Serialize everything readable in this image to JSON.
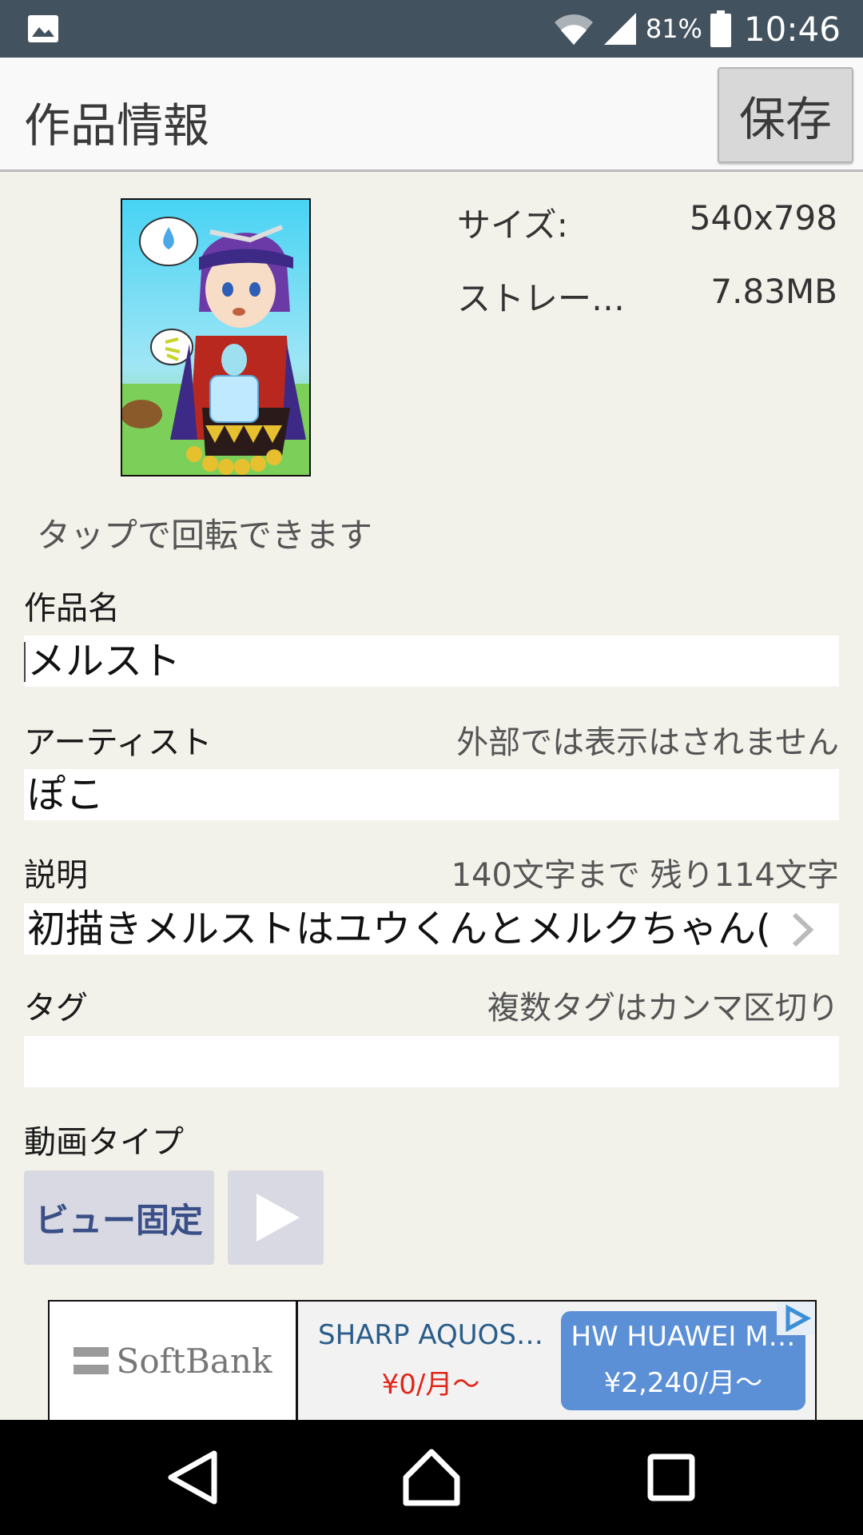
{
  "status_bar": {
    "battery": "81%",
    "time": "10:46",
    "icons": [
      "image-icon",
      "wifi-icon",
      "signal-icon",
      "battery-icon"
    ]
  },
  "header": {
    "title": "作品情報",
    "save_label": "保存"
  },
  "artwork": {
    "size_label": "サイズ:",
    "size_value": "540x798",
    "storage_label": "ストレー…",
    "storage_value": "7.83MB",
    "rotate_hint": "タップで回転できます"
  },
  "form": {
    "title_label": "作品名",
    "title_value": "メルスト",
    "artist_label": "アーティスト",
    "artist_note": "外部では表示はされません",
    "artist_value": "ぽこ",
    "desc_label": "説明",
    "desc_note": "140文字まで 残り114文字",
    "desc_value": "初描きメルストはユウくんとメルクちゃん(",
    "tags_label": "タグ",
    "tags_note": "複数タグはカンマ区切り",
    "tags_value": "",
    "video_type_label": "動画タイプ",
    "view_fixed_label": "ビュー固定"
  },
  "ad": {
    "logo_text": "SoftBank",
    "item1_name": "SHARP AQUOS…",
    "item1_price": "¥0/月〜",
    "item2_name": "HW HUAWEI M…",
    "item2_price": "¥2,240/月〜"
  },
  "colors": {
    "status_bar": "#43525f",
    "background": "#f2f1ea",
    "button_bg": "#d8d9e2",
    "button_text": "#3a4f87",
    "ad_card": "#5b8fd6",
    "ad_price": "#e0261b"
  }
}
